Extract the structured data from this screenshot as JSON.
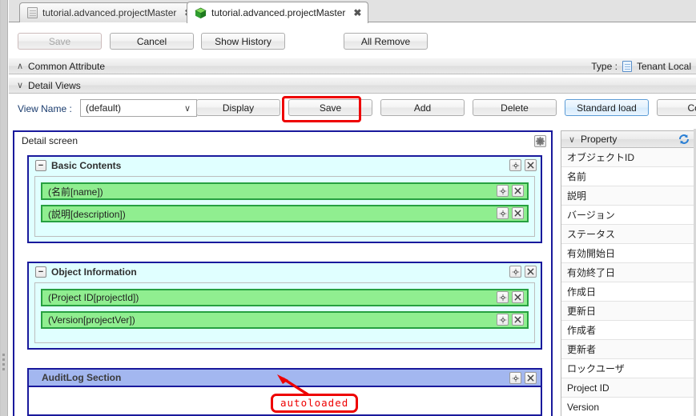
{
  "window": {
    "tabs": [
      {
        "label": "tutorial.advanced.projectMaster",
        "icon": "document-icon",
        "close": "✖",
        "active": false
      },
      {
        "label": "tutorial.advanced.projectMaster",
        "icon": "cube-icon",
        "close": "✖",
        "active": true
      }
    ]
  },
  "toolbar": {
    "save_label": "Save",
    "cancel_label": "Cancel",
    "show_history_label": "Show History",
    "all_remove_label": "All Remove"
  },
  "common_attribute": {
    "title": "Common Attribute",
    "chevron": "∧",
    "type_label": "Type :",
    "type_value": "Tenant Local",
    "type_icon": "document-icon"
  },
  "detail_views": {
    "title": "Detail Views",
    "chevron": "∨",
    "view_name_label": "View Name :",
    "view_name_value": "(default)",
    "view_name_chevron": "∨",
    "buttons": {
      "display": "Display",
      "save": "Save",
      "add": "Add",
      "delete": "Delete",
      "standard_load": "Standard load",
      "copy": "Copy"
    }
  },
  "detail_screen": {
    "title": "Detail screen",
    "gear_icon": "gear-icon",
    "sections": [
      {
        "title": "Basic Contents",
        "collapse": "−",
        "gear_icon": "gear-icon",
        "close_icon": "close-icon",
        "fields": [
          {
            "label": "(名前[name])",
            "gear_icon": "gear-icon",
            "close_icon": "close-icon"
          },
          {
            "label": "(説明[description])",
            "gear_icon": "gear-icon",
            "close_icon": "close-icon"
          }
        ]
      },
      {
        "title": "Object Information",
        "collapse": "−",
        "gear_icon": "gear-icon",
        "close_icon": "close-icon",
        "fields": [
          {
            "label": "(Project ID[projectId])",
            "gear_icon": "gear-icon",
            "close_icon": "close-icon"
          },
          {
            "label": "(Version[projectVer])",
            "gear_icon": "gear-icon",
            "close_icon": "close-icon"
          }
        ]
      }
    ],
    "audit_section": {
      "title": "AuditLog Section",
      "gear_icon": "gear-icon",
      "close_icon": "close-icon"
    }
  },
  "property_panel": {
    "title": "Property",
    "chevron": "∨",
    "refresh_icon": "refresh-icon",
    "items": [
      {
        "label": "オブジェクトID"
      },
      {
        "label": "名前"
      },
      {
        "label": "説明"
      },
      {
        "label": "バージョン"
      },
      {
        "label": "ステータス"
      },
      {
        "label": "有効開始日"
      },
      {
        "label": "有効終了日"
      },
      {
        "label": "作成日"
      },
      {
        "label": "更新日"
      },
      {
        "label": "作成者"
      },
      {
        "label": "更新者"
      },
      {
        "label": "ロックユーザ"
      },
      {
        "label": "Project ID"
      },
      {
        "label": "Version"
      }
    ]
  },
  "annotation": {
    "callout_text": "autoloaded",
    "highlight_color": "#ee0000"
  }
}
